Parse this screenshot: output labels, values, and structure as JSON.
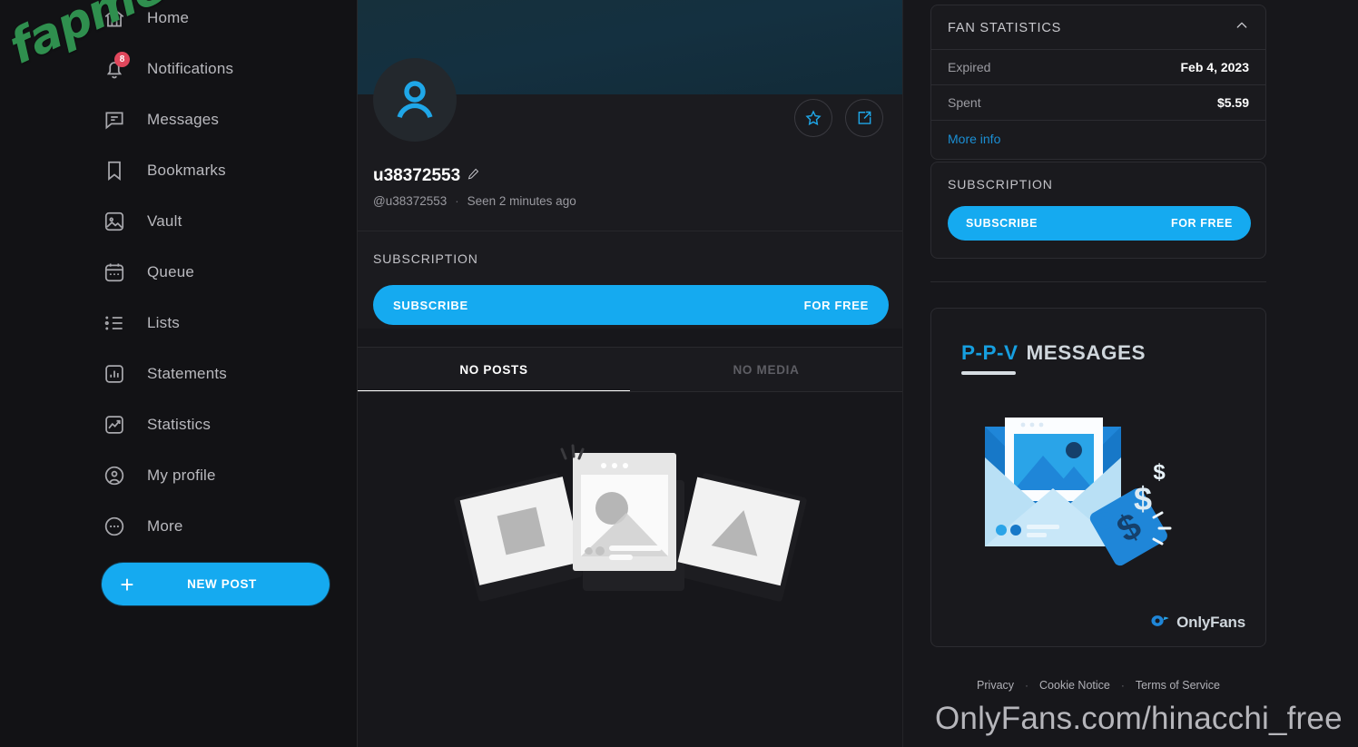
{
  "sidebar": {
    "items": [
      {
        "label": "Home",
        "icon": "home-icon",
        "badge": null
      },
      {
        "label": "Notifications",
        "icon": "bell-icon",
        "badge": "8"
      },
      {
        "label": "Messages",
        "icon": "message-icon",
        "badge": null
      },
      {
        "label": "Bookmarks",
        "icon": "bookmark-icon",
        "badge": null
      },
      {
        "label": "Vault",
        "icon": "vault-icon",
        "badge": null
      },
      {
        "label": "Queue",
        "icon": "calendar-icon",
        "badge": null
      },
      {
        "label": "Lists",
        "icon": "list-icon",
        "badge": null
      },
      {
        "label": "Statements",
        "icon": "bar-chart-icon",
        "badge": null
      },
      {
        "label": "Statistics",
        "icon": "line-chart-icon",
        "badge": null
      },
      {
        "label": "My profile",
        "icon": "user-circle-icon",
        "badge": null
      },
      {
        "label": "More",
        "icon": "ellipsis-circle-icon",
        "badge": null
      }
    ],
    "new_post_label": "NEW POST"
  },
  "profile": {
    "display_name": "u38372553",
    "handle": "@u38372553",
    "separator": "·",
    "last_seen": "Seen 2 minutes ago",
    "subscription_heading": "SUBSCRIPTION",
    "subscribe_label": "SUBSCRIBE",
    "subscribe_price": "FOR FREE",
    "tabs": [
      {
        "label": "NO POSTS",
        "active": true
      },
      {
        "label": "NO MEDIA",
        "active": false
      }
    ]
  },
  "right": {
    "fan_statistics": {
      "title": "FAN STATISTICS",
      "rows": [
        {
          "key": "Expired",
          "value": "Feb 4, 2023"
        },
        {
          "key": "Spent",
          "value": "$5.59"
        }
      ],
      "more_info_label": "More info"
    },
    "subscription": {
      "title": "SUBSCRIPTION",
      "subscribe_label": "SUBSCRIBE",
      "price_label": "FOR FREE"
    },
    "promo": {
      "title_part1": "P-P-V",
      "title_part2": "MESSAGES",
      "brand": "OnlyFans"
    },
    "footer_links": [
      {
        "label": "Privacy"
      },
      {
        "label": "Cookie Notice"
      },
      {
        "label": "Terms of Service"
      }
    ],
    "footer_separator": "·"
  },
  "watermarks": {
    "site": "fapmenu.com",
    "url": "OnlyFans.com/hinacchi_free"
  },
  "colors": {
    "accent": "#15aaf0",
    "link": "#1b8fd4",
    "badge": "#e0475c",
    "page_bg": "#17171b",
    "card_bg": "#1a1a1e",
    "watermark_green": "#2f8f4e"
  }
}
